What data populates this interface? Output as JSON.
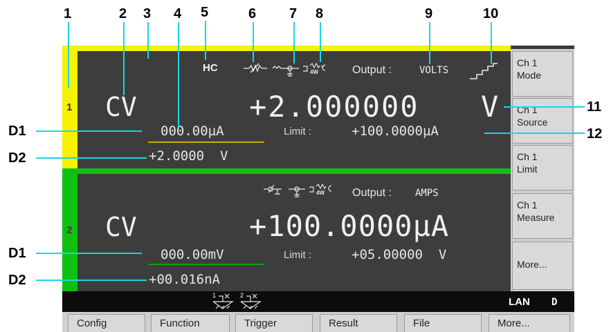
{
  "callouts": {
    "numbers": [
      "1",
      "2",
      "3",
      "4",
      "5",
      "6",
      "7",
      "8",
      "9",
      "10",
      "11",
      "12"
    ],
    "d1": "D1",
    "d2": "D2"
  },
  "channel1": {
    "number": "1",
    "mode": "CV",
    "hc_badge": "HC",
    "output_label": "Output :",
    "output_value": "VOLTS",
    "primary_value": "+2.000000",
    "primary_unit": "V",
    "d1_value": "000.00µA",
    "limit_label": "Limit :",
    "limit_value": "+100.0000µA",
    "d2_value": "+2.0000  V"
  },
  "channel2": {
    "number": "2",
    "mode": "CV",
    "output_label": "Output :",
    "output_value": "AMPS",
    "primary_value": "+100.0000µA",
    "d1_value": "000.00mV",
    "limit_label": "Limit :",
    "limit_value": "+05.00000  V",
    "d2_value": "+00.016nA"
  },
  "softkeys": [
    {
      "label": "Ch 1\nMode"
    },
    {
      "label": "Ch 1\nSource"
    },
    {
      "label": "Ch 1\nLimit"
    },
    {
      "label": "Ch 1\nMeasure"
    },
    {
      "label": "More..."
    }
  ],
  "status": {
    "lan": "LAN",
    "d": "D",
    "ch_labels": [
      "1",
      "2"
    ]
  },
  "function_keys": [
    "Config",
    "Function",
    "Trigger",
    "Result",
    "File",
    "More..."
  ],
  "colors": {
    "ch1": "#f6f200",
    "ch2": "#10c010",
    "callout_line": "#19d6e6",
    "screen_bg": "#3d3d3d"
  },
  "icons": [
    "hc-badge",
    "source-resistance-icon",
    "filter-icon",
    "four-wire-icon",
    "staircase-sweep-icon",
    "ground-icon"
  ]
}
